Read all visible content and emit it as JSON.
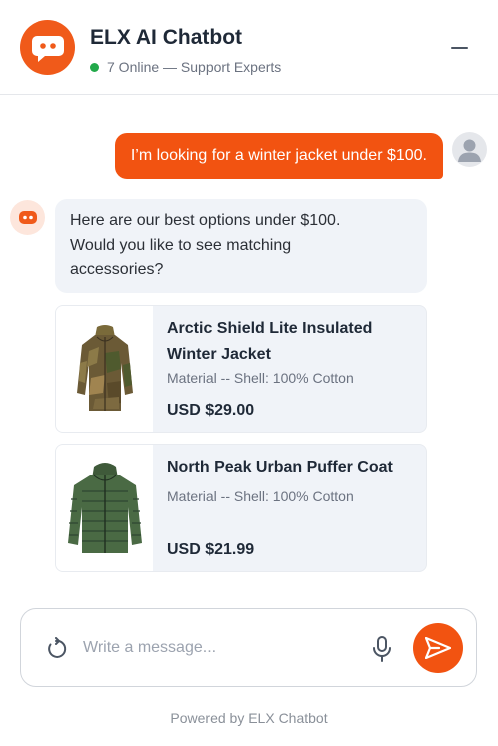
{
  "header": {
    "title": "ELX AI Chatbot",
    "status_text": "7 Online — Support Experts",
    "logo_icon": "chat-bubble-icon",
    "status_color": "#22a94a",
    "minimize_icon": "minimize-icon"
  },
  "conversation": {
    "user_message": "I’m looking for a winter jacket under $100.",
    "bot_lines": [
      "Here are our best options under $100.",
      "Would you like to see matching",
      "accessories?"
    ],
    "products": [
      {
        "name": "Arctic Shield Lite Insulated Winter Jacket",
        "material": "Material -- Shell: 100% Cotton",
        "price": "USD $29.00",
        "image_icon": "camo-jacket-image"
      },
      {
        "name": "North Peak Urban Puffer Coat",
        "material": "Material -- Shell: 100% Cotton",
        "price": "USD $21.99",
        "image_icon": "green-puffer-jacket-image"
      }
    ]
  },
  "composer": {
    "placeholder": "Write a message...",
    "value": "",
    "refresh_icon": "refresh-icon",
    "mic_icon": "microphone-icon",
    "send_icon": "send-icon"
  },
  "footer": {
    "text": "Powered by ELX Chatbot"
  },
  "colors": {
    "accent": "#f25311",
    "bubble_bg": "#f0f3f8",
    "online": "#22a94a"
  }
}
